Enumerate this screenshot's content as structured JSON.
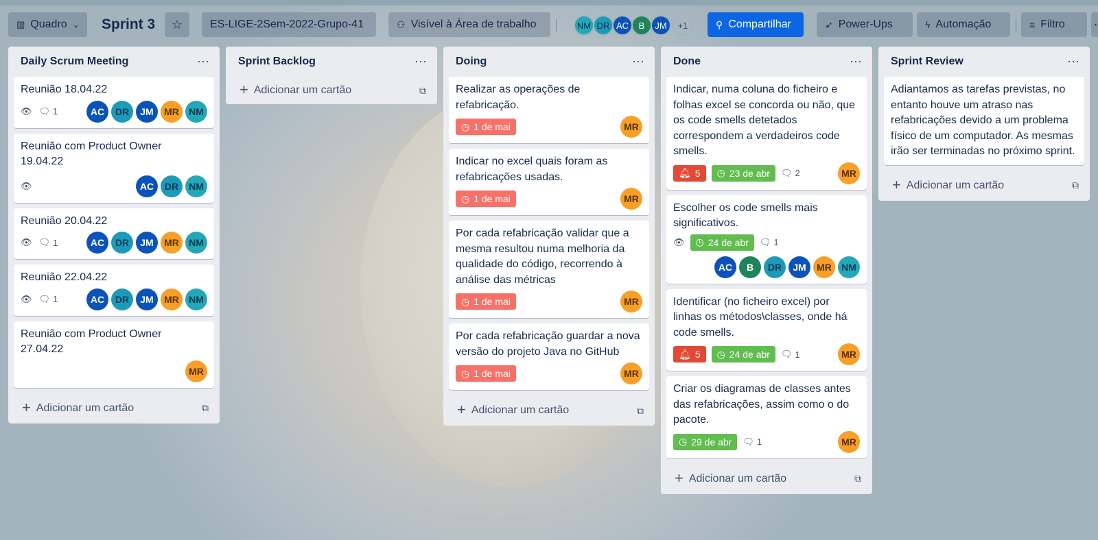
{
  "header": {
    "view_label": "Quadro",
    "board_title": "Sprint 3",
    "workspace": "ES-LIGE-2Sem-2022-Grupo-41",
    "visibility": "Visível à Área de trabalho",
    "members": [
      "NM",
      "DR",
      "AC",
      "B",
      "JM"
    ],
    "members_more": "+1",
    "share_label": "Compartilhar",
    "powerups_label": "Power-Ups",
    "automation_label": "Automação",
    "filter_label": "Filtro"
  },
  "add_card_label": "Adicionar um cartão",
  "lists": [
    {
      "title": "Daily Scrum Meeting",
      "cards": [
        {
          "title": "Reunião 18.04.22",
          "comments": "1"
        },
        {
          "title": "Reunião com Product Owner 19.04.22"
        },
        {
          "title": "Reunião 20.04.22",
          "comments": "1"
        },
        {
          "title": "Reunião 22.04.22",
          "comments": "1"
        },
        {
          "title": "Reunião com Product Owner 27.04.22"
        }
      ]
    },
    {
      "title": "Sprint Backlog",
      "cards": []
    },
    {
      "title": "Doing",
      "cards": [
        {
          "title": "Realizar as operações de refabricação.",
          "due": "1 de mai"
        },
        {
          "title": "Indicar no excel quais foram as refabricações usadas.",
          "due": "1 de mai"
        },
        {
          "title": "Por cada refabricação validar que a mesma resultou numa melhoria da qualidade do código, recorrendo à análise das métricas",
          "due": "1 de mai"
        },
        {
          "title": "Por cada refabricação guardar a nova versão do projeto Java no GitHub",
          "due": "1 de mai"
        }
      ]
    },
    {
      "title": "Done",
      "cards": [
        {
          "title": "Indicar, numa coluna do ficheiro e folhas excel se concorda ou não, que os code smells detetados correspondem a verdadeiros code smells.",
          "alerts": "5",
          "due": "23 de abr",
          "comments": "2"
        },
        {
          "title": "Escolher os code smells mais significativos.",
          "due": "24 de abr",
          "comments": "1"
        },
        {
          "title": "Identificar (no ficheiro excel) por linhas os métodos\\classes, onde há code smells.",
          "alerts": "5",
          "due": "24 de abr",
          "comments": "1"
        },
        {
          "title": "Criar os diagramas de classes antes das refabricações, assim como o do pacote.",
          "due": "29 de abr",
          "comments": "1"
        }
      ]
    },
    {
      "title": "Sprint Review",
      "cards": [
        {
          "title": "Adiantamos as tarefas previstas, no entanto houve um atraso nas refabricações devido a um problema físico de um computador. As mesmas irão ser terminadas no próximo sprint."
        }
      ]
    }
  ]
}
